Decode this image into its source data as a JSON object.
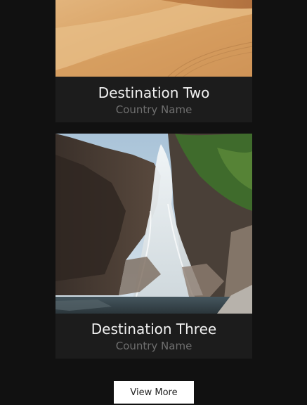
{
  "destinations": [
    {
      "title": "Destination Two",
      "country": "Country Name",
      "image": "desert-dunes-photo"
    },
    {
      "title": "Destination Three",
      "country": "Country Name",
      "image": "waterfall-photo"
    }
  ],
  "view_more_label": "View More",
  "colors": {
    "background": "#111111",
    "card": "#1c1c1c",
    "title": "#f2f2f2",
    "subtitle": "#6f6f6f",
    "button": "#ffffff"
  }
}
